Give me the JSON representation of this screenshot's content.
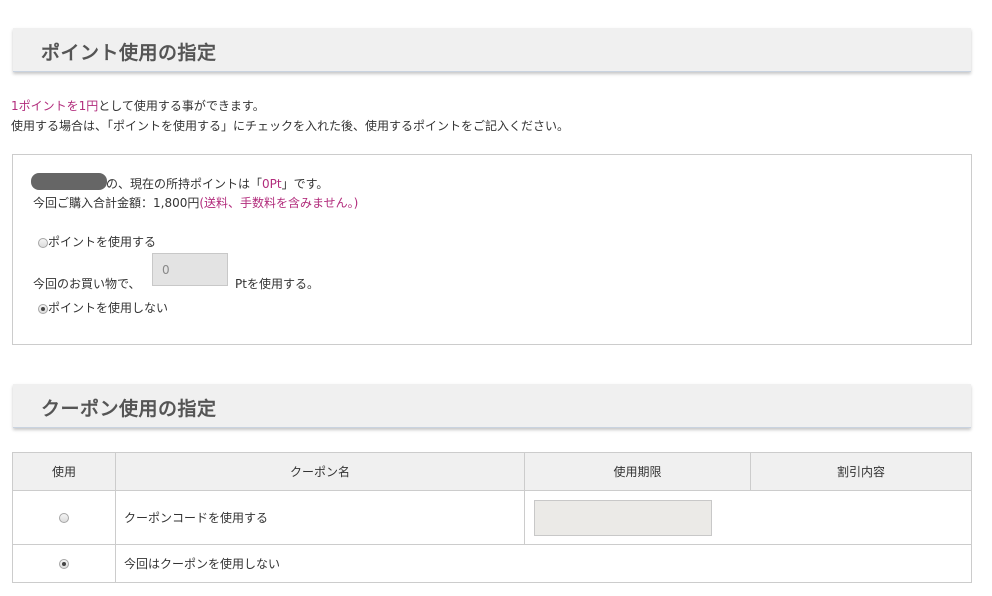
{
  "points_section": {
    "title": "ポイント使用の指定"
  },
  "intro": {
    "rate": "1ポイントを1円",
    "line1_rest": "として使用する事ができます。",
    "line2": "使用する場合は、「ポイントを使用する」にチェックを入れた後、使用するポイントをご記入ください。"
  },
  "points_box": {
    "current_prefix": "の、現在の所持ポイントは「",
    "current_points": "0Pt",
    "current_suffix": "」です。",
    "purchase_total": "今回ご購入合計金額：1,800円",
    "purchase_note": "(送料、手数料を含みません。)",
    "use_points_label": "ポイントを使用する",
    "amount_prefix": "今回のお買い物で、",
    "amount_placeholder": "0",
    "amount_suffix": "Ptを使用する。",
    "no_points_label": "ポイントを使用しない"
  },
  "coupon_section": {
    "title": "クーポン使用の指定"
  },
  "coupon_table": {
    "headers": [
      "使用",
      "クーポン名",
      "使用期限",
      "割引内容"
    ],
    "rows": [
      {
        "name": "クーポンコードを使用する",
        "selected": false
      },
      {
        "name": "今回はクーポンを使用しない",
        "selected": true
      }
    ]
  }
}
